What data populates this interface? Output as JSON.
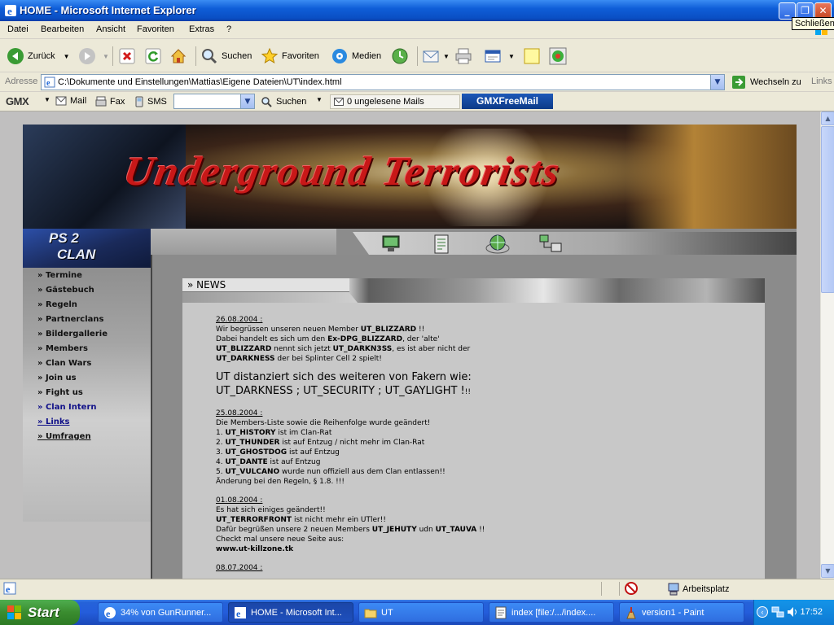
{
  "window": {
    "title": "HOME - Microsoft Internet Explorer",
    "tooltip": "Schließen"
  },
  "menubar": [
    "Datei",
    "Bearbeiten",
    "Ansicht",
    "Favoriten",
    "Extras",
    "?"
  ],
  "toolbar": {
    "back": "Zurück",
    "search": "Suchen",
    "favorites": "Favoriten",
    "media": "Medien"
  },
  "address": {
    "label": "Adresse",
    "url": "C:\\Dokumente und Einstellungen\\Mattias\\Eigene Dateien\\UT\\index.html",
    "go": "Wechseln zu",
    "links": "Links"
  },
  "gmx": {
    "logo": "GMX",
    "mail": "Mail",
    "fax": "Fax",
    "sms": "SMS",
    "search": "Suchen",
    "unread": "0 ungelesene Mails",
    "freemail": "GMXFreeMail"
  },
  "site": {
    "banner_logo": "Underground Terrorists",
    "clan_line1": "PS 2",
    "clan_line2": "CLAN",
    "nav": [
      {
        "label": "» Termine"
      },
      {
        "label": "» Gästebuch"
      },
      {
        "label": "» Regeln"
      },
      {
        "label": "» Partnerclans"
      },
      {
        "label": "» Bildergallerie"
      },
      {
        "label": "» Members"
      },
      {
        "label": "» Clan Wars"
      },
      {
        "label": "» Join us"
      },
      {
        "label": "» Fight us"
      },
      {
        "label": "» Clan Intern"
      },
      {
        "label": "» Links"
      },
      {
        "label": "» Umfragen"
      }
    ],
    "news_title": "» NEWS",
    "news": {
      "d1": "26.08.2004 :",
      "n1a": "Wir begrüssen unseren neuen Member ",
      "n1b": "UT_BLIZZARD",
      "n1c": " !!",
      "n1d": "Dabei handelt es sich um den ",
      "n1e": "Ex-DPG_BLIZZARD",
      "n1f": ", der 'alte'",
      "n1g": "UT_BLIZZARD",
      "n1h": " nennt sich jetzt ",
      "n1i": "UT_DARKN3SS",
      "n1j": ", es ist aber nicht der",
      "n1k": "UT_DARKNESS",
      "n1l": " der bei Splinter Cell 2 spielt!",
      "big1": "UT distanziert sich des weiteren von Fakern wie:",
      "big2": "UT_DARKNESS ; UT_SECURITY ; UT_GAYLIGHT !",
      "big2s": "!!",
      "d2": "25.08.2004 :",
      "n2a": "Die Members-Liste sowie die Reihenfolge wurde geändert!",
      "n2_1n": "1. ",
      "n2_1b": "UT_HISTORY",
      "n2_1t": " ist im Clan-Rat",
      "n2_2n": "2. ",
      "n2_2b": "UT_THUNDER",
      "n2_2t": " ist auf Entzug / nicht mehr im Clan-Rat",
      "n2_3n": "3. ",
      "n2_3b": "UT_GHOSTDOG",
      "n2_3t": " ist auf Entzug",
      "n2_4n": "4. ",
      "n2_4b": "UT_DANTE",
      "n2_4t": " ist auf Entzug",
      "n2_5n": "5. ",
      "n2_5b": "UT_VULCANO",
      "n2_5t": " wurde nun offiziell aus dem Clan entlassen!!",
      "n2_6": "Änderung bei den Regeln, § 1.8. !!!",
      "d3": "01.08.2004 :",
      "n3a": "Es hat sich einiges geändert!!",
      "n3b": "UT_TERRORFRONT",
      "n3c": " ist nicht mehr ein UTler!!",
      "n3d": "Dafür begrüßen unsere 2 neuen Members ",
      "n3e": "UT_JEHUTY",
      "n3f": " udn ",
      "n3g": "UT_TAUVA",
      "n3h": " !!",
      "n3i": "Checkt mal unsere neue Seite aus:",
      "n3j": "www.ut-killzone.tk",
      "d4": "08.07.2004 :"
    }
  },
  "statusbar": {
    "zone": "Arbeitsplatz"
  },
  "taskbar": {
    "start": "Start",
    "tasks": [
      {
        "label": "34% von GunRunner..."
      },
      {
        "label": "HOME - Microsoft Int..."
      },
      {
        "label": "UT"
      },
      {
        "label": "index [file:/.../index...."
      },
      {
        "label": "version1 - Paint"
      }
    ],
    "time": "17:52"
  }
}
